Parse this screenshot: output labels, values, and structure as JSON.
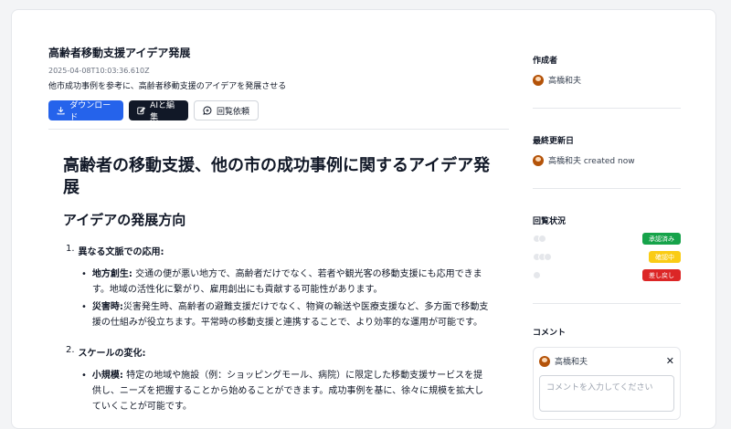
{
  "document": {
    "title": "高齢者移動支援アイデア発展",
    "timestamp": "2025-04-08T10:03:36.610Z",
    "description": "他市成功事例を参考に、高齢者移動支援のアイデアを発展させる"
  },
  "toolbar": {
    "download_label": "ダウンロード",
    "ai_edit_label": "AIと編集",
    "review_request_label": "回覧依頼"
  },
  "content": {
    "heading": "高齢者の移動支援、他の市の成功事例に関するアイデア発展",
    "section_heading": "アイデアの発展方向",
    "items": [
      {
        "number": "1.",
        "label": "異なる文脈での応用:",
        "bullets": [
          {
            "term": "地方創生:",
            "text": " 交通の便が悪い地方で、高齢者だけでなく、若者や観光客の移動支援にも応用できます。地域の活性化に繋がり、雇用創出にも貢献する可能性があります。"
          },
          {
            "term": "災害時:",
            "text": "災害発生時、高齢者の避難支援だけでなく、物資の輸送や医療支援など、多方面で移動支援の仕組みが役立ちます。平常時の移動支援と連携することで、より効率的な運用が可能です。"
          }
        ]
      },
      {
        "number": "2.",
        "label": "スケールの変化:",
        "bullets": [
          {
            "term": "小規模:",
            "text": " 特定の地域や施設（例：ショッピングモール、病院）に限定した移動支援サービスを提供し、ニーズを把握することから始めることができます。成功事例を基に、徐々に規模を拡大していくことが可能です。"
          }
        ]
      }
    ]
  },
  "sidebar": {
    "author_title": "作成者",
    "author_name": "高橋和夫",
    "updated_title": "最終更新日",
    "updated_text": "高橋和夫 created now",
    "review_title": "回覧状況",
    "review_statuses": [
      {
        "label": "承認済み",
        "color": "#16a34a"
      },
      {
        "label": "確認中",
        "color": "#facc15"
      },
      {
        "label": "差し戻し",
        "color": "#dc2626"
      }
    ],
    "comment_title": "コメント",
    "comment_user": "高橋和夫",
    "comment_placeholder": "コメントを入力してください"
  }
}
